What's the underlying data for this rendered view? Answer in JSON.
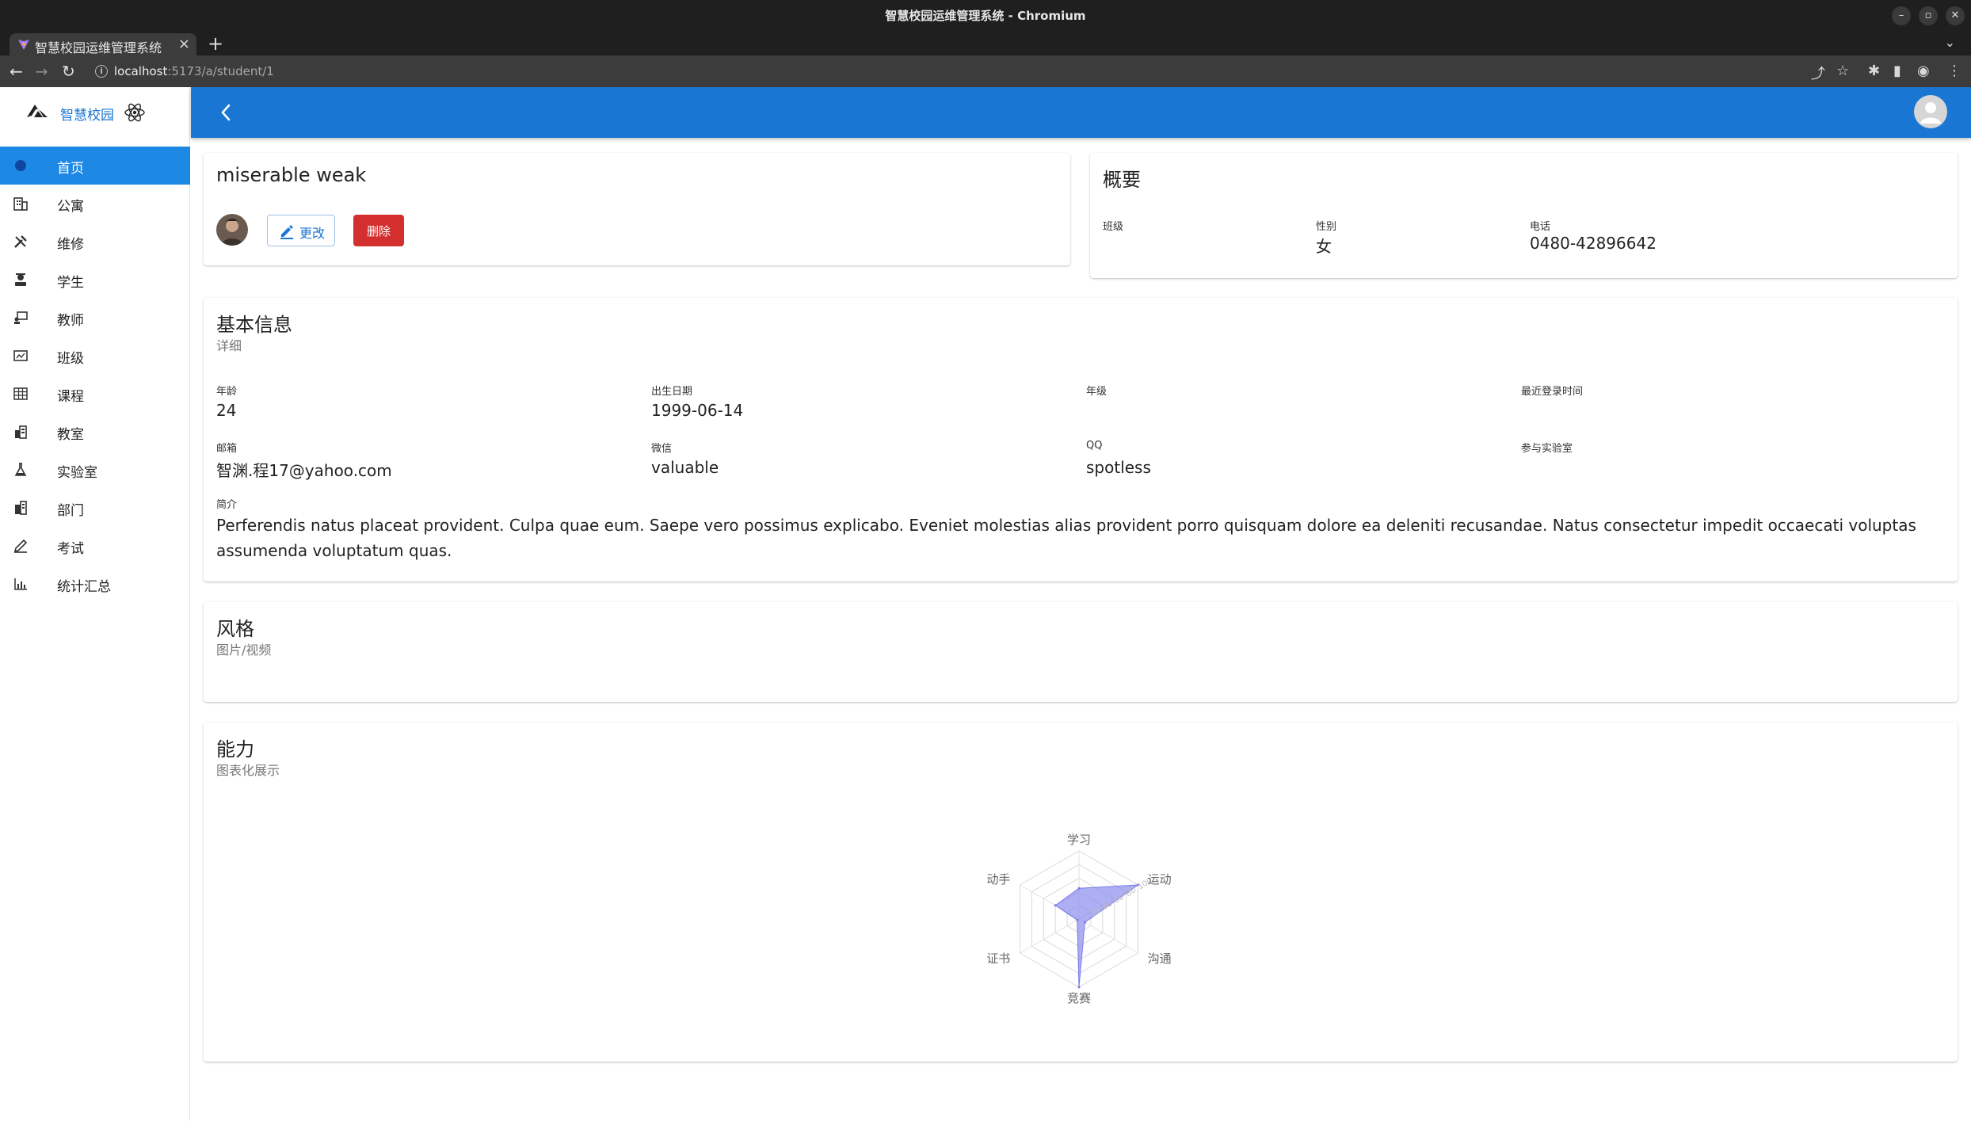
{
  "browser": {
    "window_title": "智慧校园运维管理系统 - Chromium",
    "tab_title": "智慧校园运维管理系统",
    "url_host": "localhost",
    "url_path": ":5173/a/student/1"
  },
  "sidebar": {
    "brand": "智慧校园",
    "items": [
      {
        "label": "首页",
        "icon": "dot-icon",
        "active": true
      },
      {
        "label": "公寓",
        "icon": "building-icon"
      },
      {
        "label": "维修",
        "icon": "tools-icon"
      },
      {
        "label": "学生",
        "icon": "student-icon"
      },
      {
        "label": "教师",
        "icon": "teacher-icon"
      },
      {
        "label": "班级",
        "icon": "class-icon"
      },
      {
        "label": "课程",
        "icon": "table-icon"
      },
      {
        "label": "教室",
        "icon": "classroom-icon"
      },
      {
        "label": "实验室",
        "icon": "flask-icon"
      },
      {
        "label": "部门",
        "icon": "department-icon"
      },
      {
        "label": "考试",
        "icon": "exam-icon"
      },
      {
        "label": "统计汇总",
        "icon": "chart-icon"
      }
    ]
  },
  "profile": {
    "name": "miserable weak",
    "edit_label": "更改",
    "delete_label": "删除"
  },
  "overview": {
    "title": "概要",
    "class_label": "班级",
    "class_value": "",
    "gender_label": "性别",
    "gender_value": "女",
    "phone_label": "电话",
    "phone_value": "0480-42896642"
  },
  "basic": {
    "title": "基本信息",
    "subtitle": "详细",
    "age_label": "年龄",
    "age_value": "24",
    "birth_label": "出生日期",
    "birth_value": "1999-06-14",
    "grade_label": "年级",
    "grade_value": "",
    "last_login_label": "最近登录时间",
    "last_login_value": "",
    "email_label": "邮箱",
    "email_value": "智渊.程17@yahoo.com",
    "wechat_label": "微信",
    "wechat_value": "valuable",
    "qq_label": "QQ",
    "qq_value": "spotless",
    "lab_label": "参与实验室",
    "lab_value": "",
    "intro_label": "简介",
    "intro_value": "Perferendis natus placeat provident. Culpa quae eum. Saepe vero possimus explicabo. Eveniet molestias alias provident porro quisquam dolore ea deleniti recusandae. Natus consectetur impedit occaecati voluptas assumenda voluptatum quas."
  },
  "style": {
    "title": "风格",
    "subtitle": "图片/视频"
  },
  "ability": {
    "title": "能力",
    "subtitle": "图表化展示"
  },
  "colors": {
    "appbar": "#1976d2",
    "active_nav": "#1e88e5",
    "delete": "#d32f2f",
    "radar_fill": "#8c8cf0"
  },
  "chart_data": {
    "type": "radar",
    "categories": [
      "学习",
      "运动",
      "沟通",
      "竞赛",
      "证书",
      "动手"
    ],
    "max": 100,
    "axis_ticks": [
      "20",
      "40",
      "60",
      "80",
      "100"
    ],
    "series": [
      {
        "values": [
          45,
          100,
          10,
          100,
          3,
          40
        ]
      }
    ],
    "grid": true
  }
}
